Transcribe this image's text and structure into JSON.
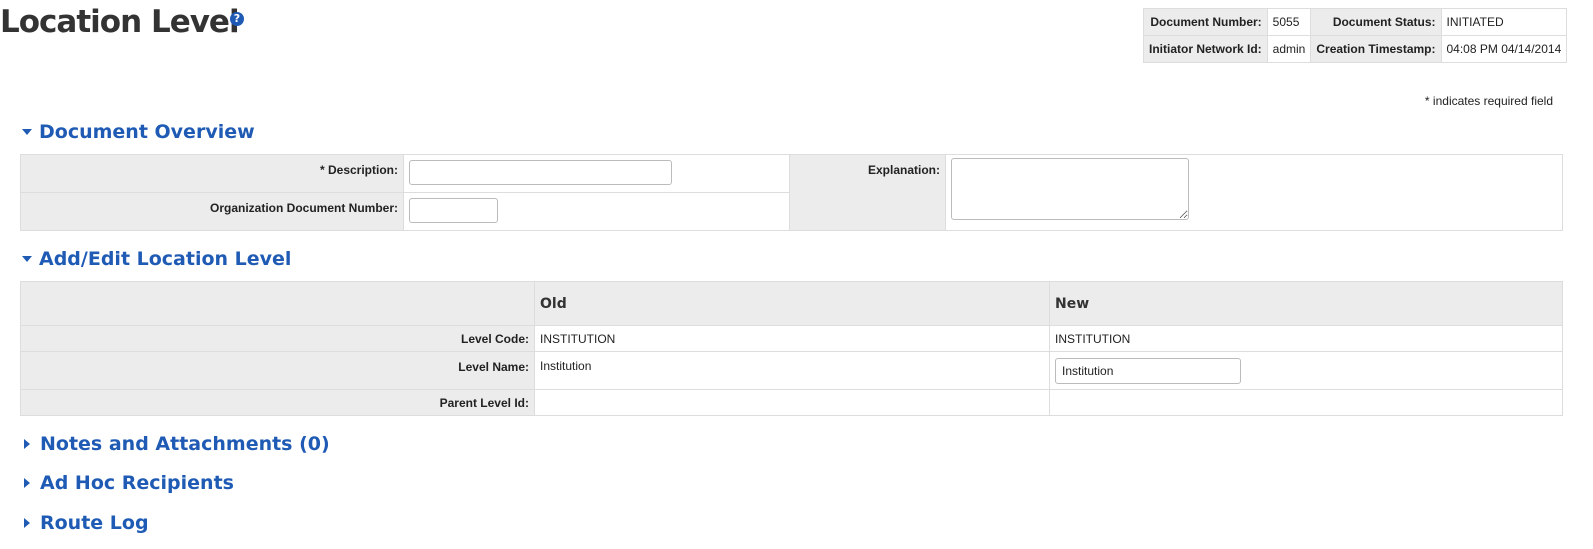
{
  "page": {
    "title": "Location Level",
    "help_icon": "?"
  },
  "doc_header": {
    "document_number_label": "Document Number:",
    "document_number": "5055",
    "document_status_label": "Document Status:",
    "document_status": "INITIATED",
    "initiator_label": "Initiator Network Id:",
    "initiator": "admin",
    "creation_label": "Creation Timestamp:",
    "creation": "04:08 PM 04/14/2014"
  },
  "required_note": "* indicates required field",
  "overview": {
    "title": "Document Overview",
    "description_label": "* Description:",
    "description_value": "",
    "org_doc_number_label": "Organization Document Number:",
    "org_doc_number_value": "",
    "explanation_label": "Explanation:",
    "explanation_value": ""
  },
  "location_level": {
    "title": "Add/Edit Location Level",
    "old_header": "Old",
    "new_header": "New",
    "rows": {
      "level_code": {
        "label": "Level Code:",
        "old": "INSTITUTION",
        "new": "INSTITUTION"
      },
      "level_name": {
        "label": "Level Name:",
        "old": "Institution",
        "new": "Institution"
      },
      "parent_level": {
        "label": "Parent Level Id:",
        "old": "",
        "new": ""
      }
    }
  },
  "collapsed_sections": {
    "notes": "Notes and Attachments (0)",
    "adhoc": "Ad Hoc Recipients",
    "route_log": "Route Log"
  }
}
